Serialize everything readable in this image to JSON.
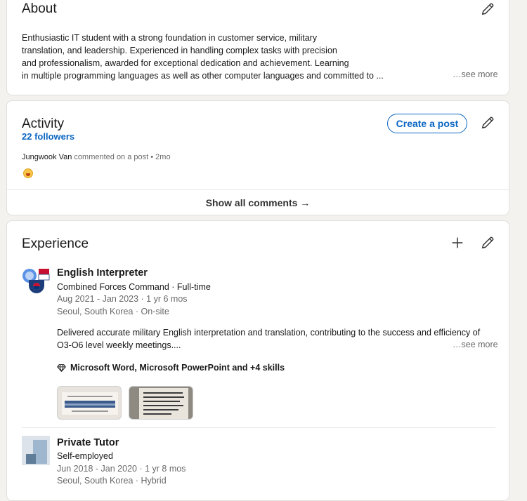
{
  "about": {
    "title": "About",
    "lines": [
      "Enthusiastic IT student with a strong foundation in customer service, military",
      "translation, and leadership. Experienced in handling complex tasks with precision",
      "and professionalism, awarded for exceptional dedication and achievement. Learning",
      "in multiple programming languages as well as other computer languages and committed to ..."
    ],
    "see_more": "…see more",
    "edit_icon": "pencil-icon"
  },
  "activity": {
    "title": "Activity",
    "followers": "22 followers",
    "create_post": "Create a post",
    "post_author": "Jungwook Van",
    "post_text": " commented on a post • 2mo",
    "show_all": "Show all comments →",
    "edit_icon": "pencil-icon"
  },
  "experience": {
    "title": "Experience",
    "add_icon": "plus-icon",
    "edit_icon": "pencil-icon",
    "items": [
      {
        "title": "English Interpreter",
        "company": "Combined Forces Command · Full-time",
        "dates": "Aug 2021 - Jan 2023 · 1 yr 6 mos",
        "location": "Seoul, South Korea · On-site",
        "description_lines": [
          "Delivered accurate military English interpretation and translation, contributing to the success and efficiency of",
          "O3-O6 level weekly meetings...."
        ],
        "see_more": "…see more",
        "skills": "Microsoft Word, Microsoft PowerPoint and +4 skills"
      },
      {
        "title": "Private Tutor",
        "company": "Self-employed",
        "dates": "Jun 2018 - Jan 2020 · 1 yr 8 mos",
        "location": "Seoul, South Korea · Hybrid"
      }
    ]
  },
  "colors": {
    "accent": "#0a66c2",
    "page_bg": "#f4f2ee",
    "card_bg": "#ffffff"
  }
}
